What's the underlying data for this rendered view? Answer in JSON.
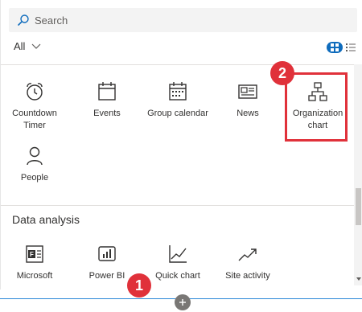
{
  "search": {
    "placeholder": "Search"
  },
  "filter": {
    "label": "All"
  },
  "tiles": [
    {
      "label": "Countdown Timer",
      "icon": "alarm-clock-icon"
    },
    {
      "label": "Events",
      "icon": "calendar-icon"
    },
    {
      "label": "Group calendar",
      "icon": "group-calendar-icon"
    },
    {
      "label": "News",
      "icon": "news-icon"
    },
    {
      "label": "Organization chart",
      "icon": "org-chart-icon"
    },
    {
      "label": "People",
      "icon": "person-icon"
    }
  ],
  "data_analysis": {
    "title": "Data analysis",
    "tiles": [
      {
        "label": "Microsoft",
        "icon": "microsoft-forms-icon"
      },
      {
        "label": "Power BI",
        "icon": "power-bi-icon"
      },
      {
        "label": "Quick chart",
        "icon": "line-chart-icon"
      },
      {
        "label": "Site activity",
        "icon": "trend-icon"
      }
    ]
  },
  "annotations": {
    "step1": "1",
    "step2": "2"
  },
  "colors": {
    "accent": "#0f6cbd",
    "highlight": "#e0313a"
  }
}
